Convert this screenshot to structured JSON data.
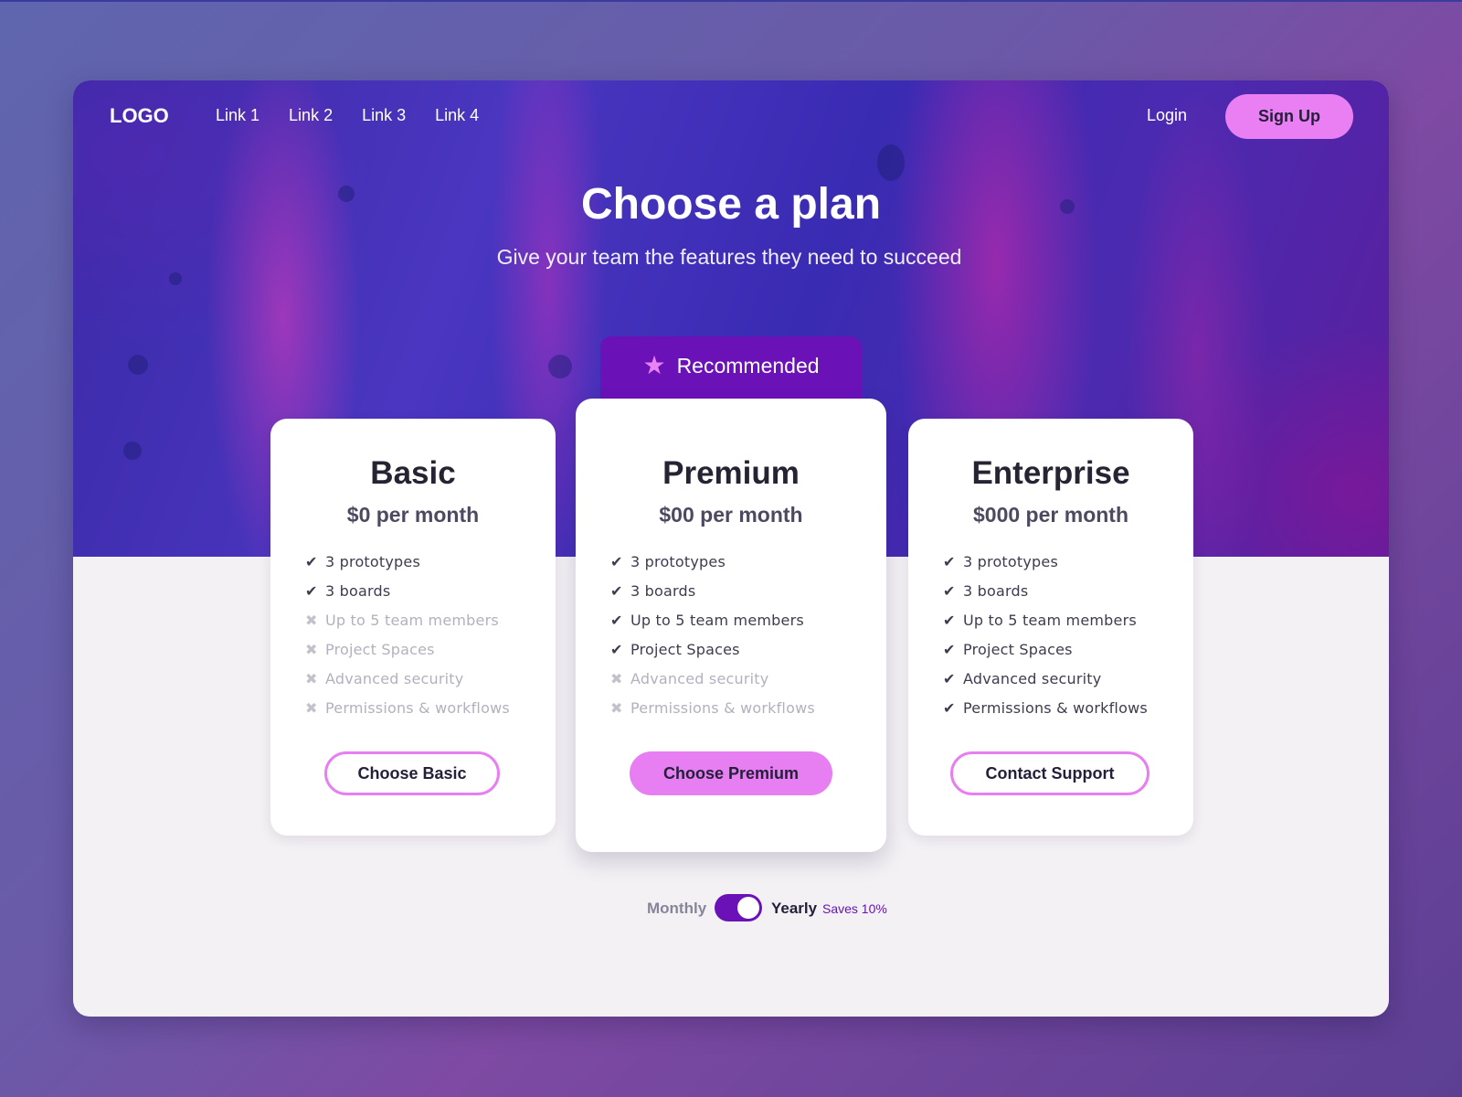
{
  "nav": {
    "logo": "LOGO",
    "links": [
      "Link 1",
      "Link 2",
      "Link 3",
      "Link 4"
    ],
    "login": "Login",
    "signup": "Sign Up"
  },
  "hero": {
    "title": "Choose a plan",
    "subtitle": "Give your team the features they need to succeed"
  },
  "recommended": {
    "label": "Recommended",
    "icon": "star-icon"
  },
  "plans": [
    {
      "name": "Basic",
      "price": "$0 per month",
      "button": "Choose Basic",
      "features": [
        {
          "label": "3 prototypes",
          "included": true
        },
        {
          "label": "3 boards",
          "included": true
        },
        {
          "label": "Up to 5 team members",
          "included": false
        },
        {
          "label": "Project Spaces",
          "included": false
        },
        {
          "label": "Advanced security",
          "included": false
        },
        {
          "label": "Permissions & workflows",
          "included": false
        }
      ]
    },
    {
      "name": "Premium",
      "price": "$00 per month",
      "button": "Choose Premium",
      "features": [
        {
          "label": "3 prototypes",
          "included": true
        },
        {
          "label": "3 boards",
          "included": true
        },
        {
          "label": "Up to 5 team members",
          "included": true
        },
        {
          "label": "Project Spaces",
          "included": true
        },
        {
          "label": "Advanced security",
          "included": false
        },
        {
          "label": "Permissions & workflows",
          "included": false
        }
      ]
    },
    {
      "name": "Enterprise",
      "price": "$000 per month",
      "button": "Contact Support",
      "features": [
        {
          "label": "3 prototypes",
          "included": true
        },
        {
          "label": "3 boards",
          "included": true
        },
        {
          "label": "Up to 5 team members",
          "included": true
        },
        {
          "label": "Project Spaces",
          "included": true
        },
        {
          "label": "Advanced security",
          "included": true
        },
        {
          "label": "Permissions & workflows",
          "included": true
        }
      ]
    }
  ],
  "billing": {
    "monthly": "Monthly",
    "yearly": "Yearly",
    "savings": "Saves 10%",
    "selected": "Yearly"
  },
  "colors": {
    "accent": "#e77ef2",
    "primary": "#6a12b8",
    "text": "#24203a"
  }
}
